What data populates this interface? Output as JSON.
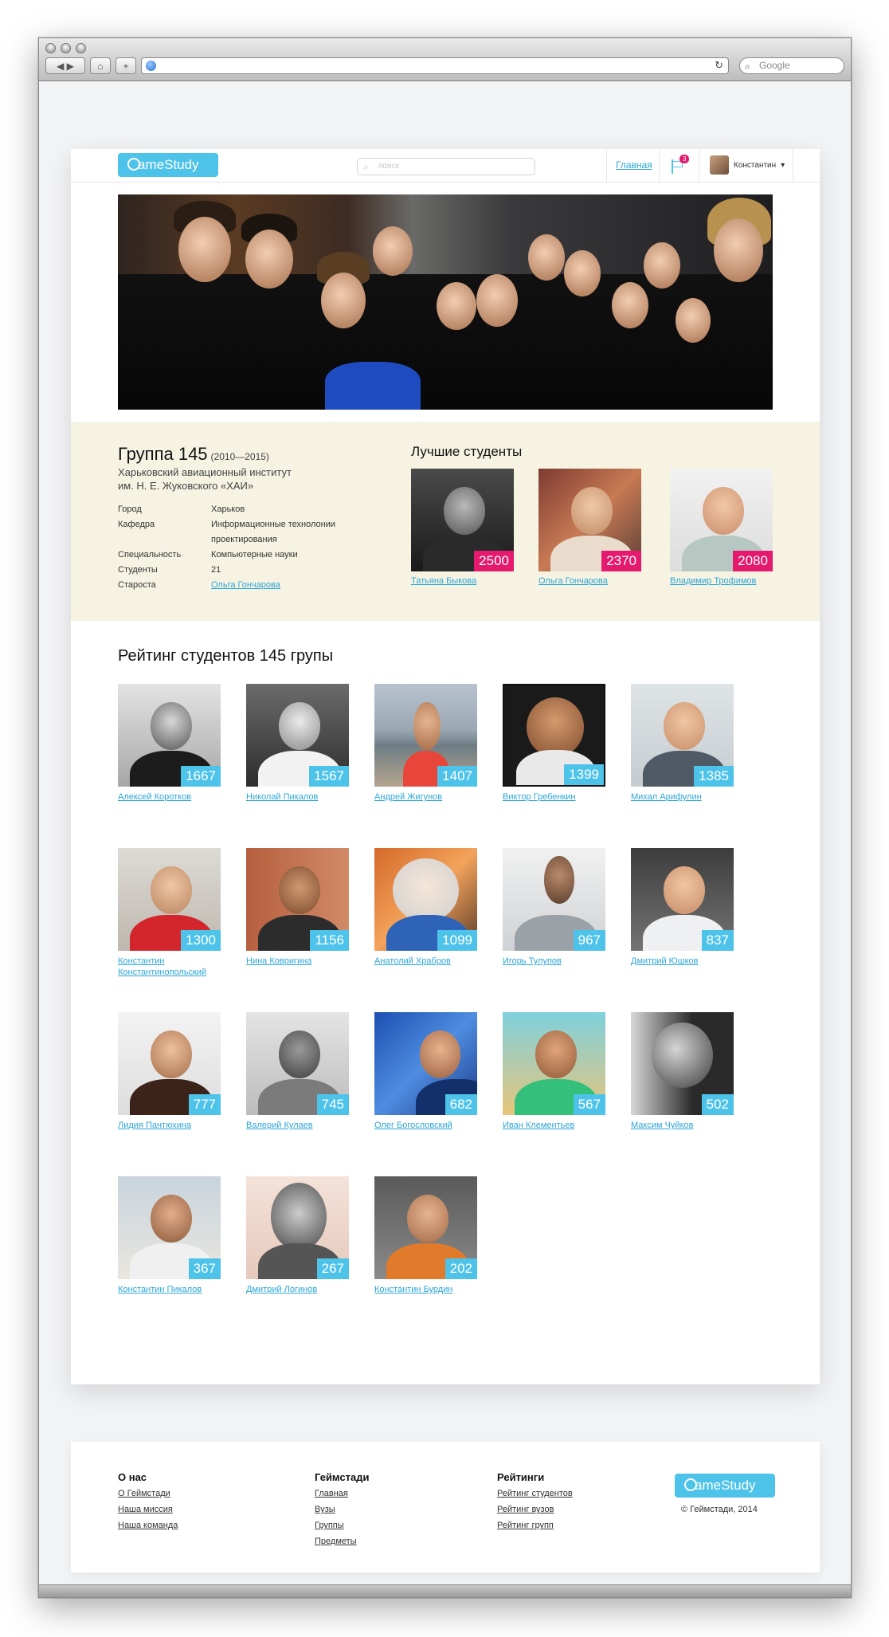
{
  "browser": {
    "search_placeholder": "Google"
  },
  "header": {
    "logo_text": "ameStudy",
    "search_placeholder": "поиск",
    "nav_home": "Главная",
    "notifications_count": "3",
    "user_name": "Константин"
  },
  "group": {
    "title": "Группа 145",
    "years": "(2010—2015)",
    "university_line1": "Харьковский авиационный институт",
    "university_line2": "им. Н. Е. Жуковского «ХАИ»",
    "info": [
      {
        "key": "Город",
        "value": "Харьков"
      },
      {
        "key": "Кафедра",
        "value": "Информационные технолонии проектирования"
      },
      {
        "key": "Специальность",
        "value": "Компьютерные науки"
      },
      {
        "key": "Студенты",
        "value": "21"
      },
      {
        "key": "Староста",
        "value": "Ольга Гончарова"
      }
    ]
  },
  "best": {
    "title": "Лучшие студенты",
    "students": [
      {
        "name": "Татьяна Быкова",
        "score": "2500"
      },
      {
        "name": "Ольга Гончарова",
        "score": "2370"
      },
      {
        "name": "Владимир Трофимов",
        "score": "2080"
      }
    ]
  },
  "ranking": {
    "title": "Рейтинг студентов 145 групы",
    "students": [
      {
        "name": "Алексей Коротков",
        "score": "1667"
      },
      {
        "name": "Николай Пикалов",
        "score": "1567"
      },
      {
        "name": "Андрей Жигунов",
        "score": "1407"
      },
      {
        "name": "Виктор Гребенкин",
        "score": "1399"
      },
      {
        "name": "Михал Арифулин",
        "score": "1385"
      },
      {
        "name": "Константин Константинопольский",
        "score": "1300"
      },
      {
        "name": "Нина Ковригина",
        "score": "1156"
      },
      {
        "name": "Анатолий Храбров",
        "score": "1099"
      },
      {
        "name": "Игорь Тулупов",
        "score": "967"
      },
      {
        "name": "Дмитрий Юшков",
        "score": "837"
      },
      {
        "name": "Лидия Пантюхина",
        "score": "777"
      },
      {
        "name": "Валерий Кулаев",
        "score": "745"
      },
      {
        "name": "Олег Богословский",
        "score": "682"
      },
      {
        "name": "Иван Клементьев",
        "score": "567"
      },
      {
        "name": "Максим Чуйков",
        "score": "502"
      },
      {
        "name": "Константин Пикалов",
        "score": "367"
      },
      {
        "name": "Дмитрий Логинов",
        "score": "267"
      },
      {
        "name": "Константин Бурдин",
        "score": "202"
      }
    ]
  },
  "footer": {
    "about": {
      "title": "О нас",
      "links": [
        "О Геймстади",
        "Наша миссия",
        "Наша команда"
      ]
    },
    "site": {
      "title": "Геймстади",
      "links": [
        "Главная",
        "Вузы",
        "Группы",
        "Предметы"
      ]
    },
    "ratings": {
      "title": "Рейтинги",
      "links": [
        "Рейтинг студентов",
        "Рейтинг вузов",
        "Рейтинг групп"
      ]
    },
    "logo_text": "ameStudy",
    "copyright": "© Геймстади, 2014"
  },
  "colors": {
    "accent": "#4ec3ea",
    "highlight": "#e5196e",
    "band": "#f6f3e3"
  }
}
